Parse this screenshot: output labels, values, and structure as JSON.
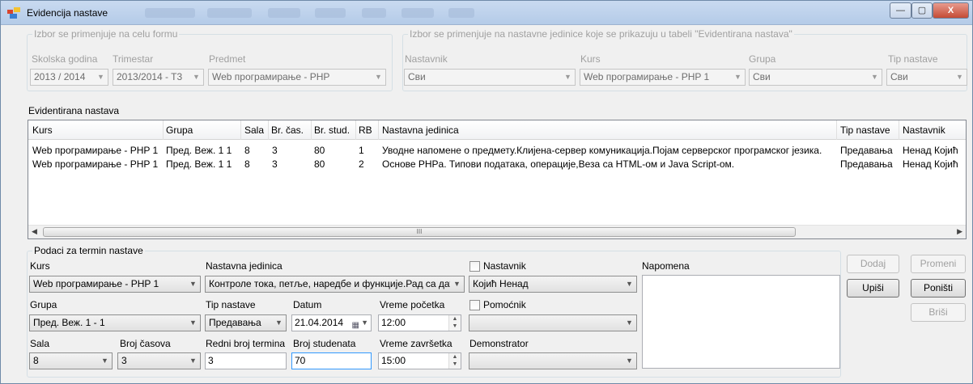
{
  "window": {
    "title": "Evidencija nastave",
    "minimize_label": "—",
    "maximize_label": "▢",
    "close_label": "X"
  },
  "form_filter": {
    "legend": "Izbor se primenjuje na celu formu",
    "school_year": {
      "label": "Skolska godina",
      "value": "2013 / 2014"
    },
    "trimester": {
      "label": "Trimestar",
      "value": "2013/2014 - T3"
    },
    "subject": {
      "label": "Predmet",
      "value": "Web програмирање - PHP"
    }
  },
  "table_filter": {
    "legend": "Izbor se primenjuje na nastavne jedinice koje se prikazuju u tabeli \"Evidentirana nastava\"",
    "teacher": {
      "label": "Nastavnik",
      "value": "Сви"
    },
    "course": {
      "label": "Kurs",
      "value": "Web програмирање - PHP 1"
    },
    "group": {
      "label": "Grupa",
      "value": "Сви"
    },
    "class_type": {
      "label": "Tip nastave",
      "value": "Сви"
    }
  },
  "grid": {
    "title": "Evidentirana nastava",
    "columns": [
      "Kurs",
      "Grupa",
      "Sala",
      "Br. čas.",
      "Br. stud.",
      "RB",
      "Nastavna jedinica",
      "Tip nastave",
      "Nastavnik"
    ],
    "rows": [
      [
        "Web програмирање - PHP 1",
        "Пред. Веж. 1 1",
        "8",
        "3",
        "80",
        "1",
        "Уводне напомене о предмету.Клијена-сервер комуникација.Појам серверског програмског језика.",
        "Предавања",
        "Ненад Којић"
      ],
      [
        "Web програмирање - PHP 1",
        "Пред. Веж. 1 1",
        "8",
        "3",
        "80",
        "2",
        "Основе PHPа. Типови података, операције,Веза са HTML-ом и Java Script-ом.",
        "Предавања",
        "Ненад Којић"
      ]
    ],
    "scroll_grip": "III"
  },
  "term": {
    "legend": "Podaci za termin nastave",
    "course": {
      "label": "Kurs",
      "value": "Web програмирање - PHP 1"
    },
    "teaching_unit": {
      "label": "Nastavna jedinica",
      "value": "Контроле тока, петље, наредбе и функције.Рад са датотекама"
    },
    "teacher": {
      "label": "Nastavnik",
      "value": "Којић Ненад"
    },
    "note": {
      "label": "Napomena",
      "value": ""
    },
    "group": {
      "label": "Grupa",
      "value": "Пред. Веж. 1 - 1"
    },
    "class_type": {
      "label": "Tip nastave",
      "value": "Предавања"
    },
    "date": {
      "label": "Datum",
      "value": "21.04.2014"
    },
    "start_time": {
      "label": "Vreme početka",
      "value": "12:00"
    },
    "assistant": {
      "label": "Pomoćnik",
      "value": ""
    },
    "room": {
      "label": "Sala",
      "value": "8"
    },
    "hours": {
      "label": "Broj časova",
      "value": "3"
    },
    "term_number": {
      "label": "Redni broj termina",
      "value": "3"
    },
    "students": {
      "label": "Broj studenata",
      "value": "70"
    },
    "end_time": {
      "label": "Vreme završetka",
      "value": "15:00"
    },
    "demonstrator": {
      "label": "Demonstrator",
      "value": ""
    }
  },
  "buttons": {
    "add": "Dodaj",
    "change": "Promeni",
    "write": "Upiši",
    "cancel": "Poništi",
    "delete": "Briši"
  }
}
